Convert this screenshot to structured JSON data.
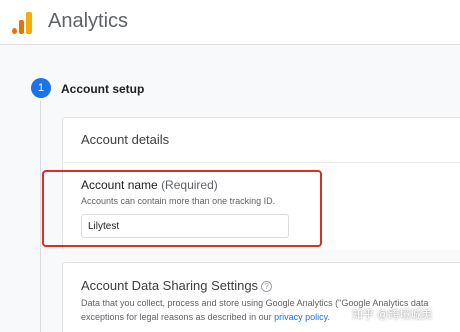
{
  "app": {
    "title": "Analytics",
    "logo": "google-analytics-logo"
  },
  "step": {
    "number": "1",
    "title": "Account setup"
  },
  "account_details": {
    "heading": "Account details",
    "account_name": {
      "label": "Account name",
      "required_label": "(Required)",
      "hint": "Accounts can contain more than one tracking ID.",
      "value": "Lilytest"
    }
  },
  "sharing": {
    "heading": "Account Data Sharing Settings",
    "help_icon": "?",
    "body_line1": "Data that you collect, process and store using Google Analytics (\"Google Analytics data",
    "body_line2_prefix": "exceptions for legal reasons as described in our ",
    "privacy_link": "privacy policy",
    "body_line2_suffix": "."
  },
  "watermark": "知乎 @跨境城美",
  "colors": {
    "accent": "#1a73e8",
    "highlight": "#d93025",
    "logo_orange": "#e37400",
    "logo_yellow": "#f9ab00"
  }
}
